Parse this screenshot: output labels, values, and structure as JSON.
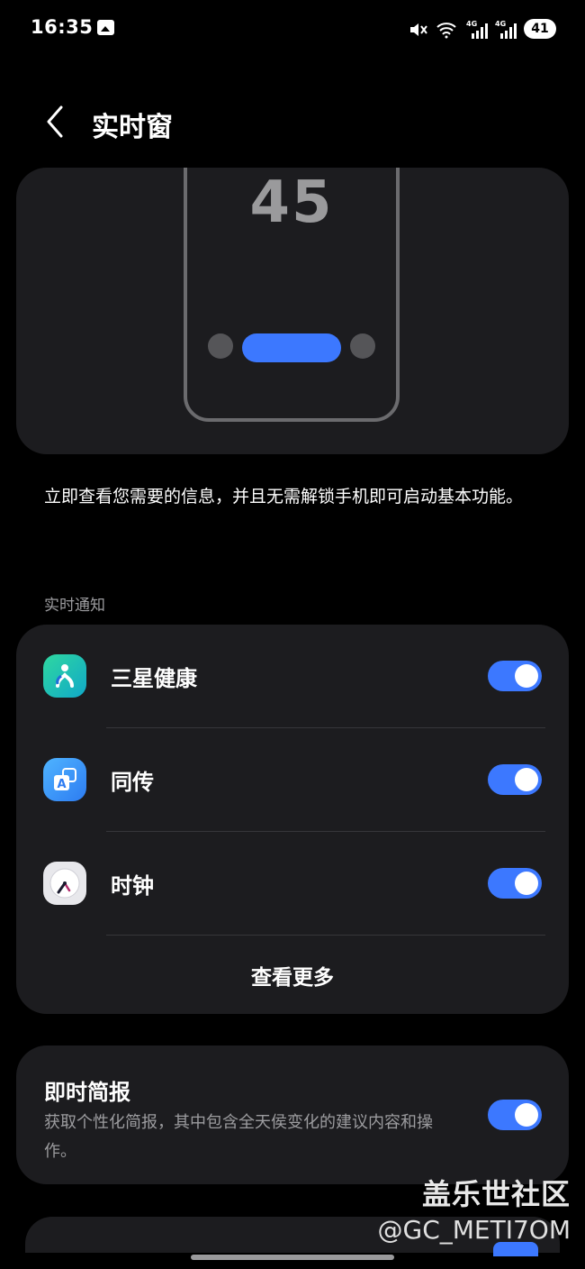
{
  "status_bar": {
    "time": "16:35",
    "battery": "41",
    "icons": [
      "image-icon",
      "mute-icon",
      "wifi-icon",
      "signal-4g-icon",
      "signal-4g-icon"
    ]
  },
  "header": {
    "title": "实时窗"
  },
  "preview": {
    "clock": "45"
  },
  "description": "立即查看您需要的信息，并且无需解锁手机即可启动基本功能。",
  "section_live_notifications": {
    "title": "实时通知",
    "items": [
      {
        "label": "三星健康",
        "icon": "samsung-health-icon",
        "enabled": true
      },
      {
        "label": "同传",
        "icon": "interpreter-icon",
        "enabled": true
      },
      {
        "label": "时钟",
        "icon": "clock-icon",
        "enabled": true
      }
    ],
    "see_more": "查看更多"
  },
  "briefing": {
    "title": "即时简报",
    "description": "获取个性化简报，其中包含全天侯变化的建议内容和操作。",
    "enabled": true
  },
  "watermark": {
    "line1": "盖乐世社区",
    "line2": "@GC_METI7OM"
  },
  "colors": {
    "background": "#000000",
    "card": "#1c1c1f",
    "accent": "#3c78ff",
    "secondary_text": "#9c9c9f"
  }
}
